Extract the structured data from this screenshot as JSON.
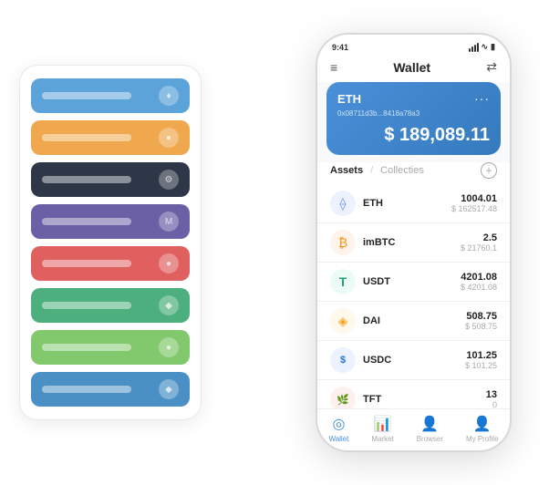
{
  "scene": {
    "cards": [
      {
        "color": "ci-blue",
        "icon": "♦"
      },
      {
        "color": "ci-orange",
        "icon": "●"
      },
      {
        "color": "ci-dark",
        "icon": "⚙"
      },
      {
        "color": "ci-purple",
        "icon": "M"
      },
      {
        "color": "ci-red",
        "icon": "●"
      },
      {
        "color": "ci-green",
        "icon": "◆"
      },
      {
        "color": "ci-lightgreen",
        "icon": "●"
      },
      {
        "color": "ci-blue2",
        "icon": "◆"
      }
    ]
  },
  "phone": {
    "status_time": "9:41",
    "header": {
      "title": "Wallet"
    },
    "eth_card": {
      "label": "ETH",
      "address": "0x08711d3b...8418a78a3",
      "balance": "$ 189,089.11",
      "more": "···"
    },
    "assets": {
      "active_tab": "Assets",
      "inactive_tab": "Collecties",
      "separator": "/",
      "items": [
        {
          "name": "ETH",
          "icon": "⟠",
          "amount": "1004.01",
          "value": "$ 162517.48",
          "icon_class": "icon-eth"
        },
        {
          "name": "imBTC",
          "icon": "₿",
          "amount": "2.5",
          "value": "$ 21760.1",
          "icon_class": "icon-imbtc"
        },
        {
          "name": "USDT",
          "icon": "T",
          "amount": "4201.08",
          "value": "$ 4201.08",
          "icon_class": "icon-usdt"
        },
        {
          "name": "DAI",
          "icon": "◈",
          "amount": "508.75",
          "value": "$ 508.75",
          "icon_class": "icon-dai"
        },
        {
          "name": "USDC",
          "icon": "©",
          "amount": "101.25",
          "value": "$ 101.25",
          "icon_class": "icon-usdc"
        },
        {
          "name": "TFT",
          "icon": "🌿",
          "amount": "13",
          "value": "0",
          "icon_class": "icon-tft"
        }
      ]
    },
    "nav": {
      "items": [
        {
          "label": "Wallet",
          "active": true
        },
        {
          "label": "Market",
          "active": false
        },
        {
          "label": "Browser",
          "active": false
        },
        {
          "label": "My Profile",
          "active": false
        }
      ]
    }
  }
}
